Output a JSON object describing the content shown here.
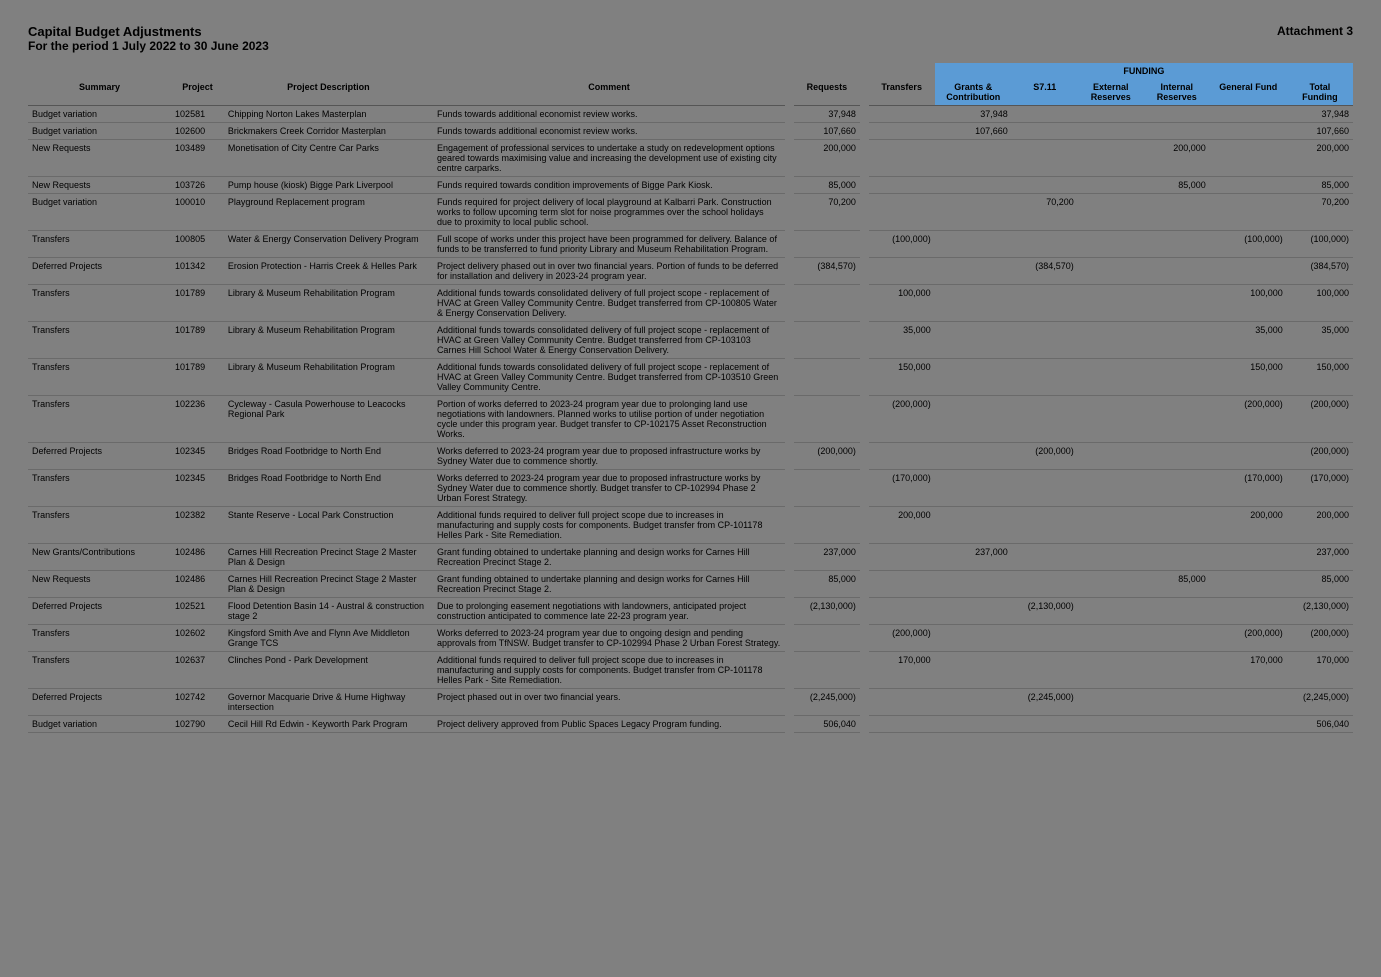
{
  "header": {
    "title": "Capital Budget Adjustments",
    "subtitle": "For the period 1 July 2022 to 30 June 2023",
    "attachment": "Attachment 3"
  },
  "columns": {
    "summary": "Summary",
    "project": "Project",
    "desc": "Project Description",
    "comment": "Comment",
    "requests": "Requests",
    "transfers": "Transfers",
    "grants": "Grants & Contribution",
    "s711": "S7.11",
    "external": "External Reserves",
    "internal": "Internal Reserves",
    "general": "General Fund",
    "total": "Total Funding",
    "funding_group": "FUNDING"
  },
  "rows": [
    {
      "summary": "Budget variation",
      "project": "102581",
      "desc": "Chipping Norton Lakes Masterplan",
      "comment": "Funds towards additional economist review works.",
      "requests": "37,948",
      "transfers": "",
      "grants": "37,948",
      "s711": "",
      "external": "",
      "internal": "",
      "general": "",
      "total": "37,948"
    },
    {
      "summary": "Budget variation",
      "project": "102600",
      "desc": "Brickmakers Creek Corridor Masterplan",
      "comment": "Funds towards additional economist review works.",
      "requests": "107,660",
      "transfers": "",
      "grants": "107,660",
      "s711": "",
      "external": "",
      "internal": "",
      "general": "",
      "total": "107,660"
    },
    {
      "summary": "New Requests",
      "project": "103489",
      "desc": "Monetisation of City Centre Car Parks",
      "comment": "Engagement of professional services to undertake a study on redevelopment options geared towards maximising value and increasing the development use of existing city centre carparks.",
      "requests": "200,000",
      "transfers": "",
      "grants": "",
      "s711": "",
      "external": "",
      "internal": "200,000",
      "general": "",
      "total": "200,000"
    },
    {
      "summary": "New Requests",
      "project": "103726",
      "desc": "Pump house (kiosk) Bigge Park Liverpool",
      "comment": "Funds required towards condition improvements of Bigge Park Kiosk.",
      "requests": "85,000",
      "transfers": "",
      "grants": "",
      "s711": "",
      "external": "",
      "internal": "85,000",
      "general": "",
      "total": "85,000"
    },
    {
      "summary": "Budget variation",
      "project": "100010",
      "desc": "Playground Replacement program",
      "comment": "Funds required for project delivery of local playground at Kalbarri Park. Construction works to follow upcoming term slot for noise programmes over the school holidays due to proximity to local public school.",
      "requests": "70,200",
      "transfers": "",
      "grants": "",
      "s711": "70,200",
      "external": "",
      "internal": "",
      "general": "",
      "total": "70,200"
    },
    {
      "summary": "Transfers",
      "project": "100805",
      "desc": "Water & Energy Conservation Delivery Program",
      "comment": "Full scope of works under this project have been programmed for delivery. Balance of funds to be transferred to fund priority Library and Museum Rehabilitation Program.",
      "requests": "",
      "transfers": "(100,000)",
      "grants": "",
      "s711": "",
      "external": "",
      "internal": "",
      "general": "(100,000)",
      "total": "(100,000)"
    },
    {
      "summary": "Deferred Projects",
      "project": "101342",
      "desc": "Erosion Protection - Harris Creek & Helles Park",
      "comment": "Project delivery phased out in over two financial years. Portion of funds to be deferred for installation and delivery in 2023-24 program year.",
      "requests": "(384,570)",
      "transfers": "",
      "grants": "",
      "s711": "(384,570)",
      "external": "",
      "internal": "",
      "general": "",
      "total": "(384,570)"
    },
    {
      "summary": "Transfers",
      "project": "101789",
      "desc": "Library & Museum Rehabilitation Program",
      "comment": "Additional funds towards consolidated delivery of full project scope - replacement of HVAC at Green Valley Community Centre. Budget transferred from CP-100805 Water & Energy Conservation Delivery.",
      "requests": "",
      "transfers": "100,000",
      "grants": "",
      "s711": "",
      "external": "",
      "internal": "",
      "general": "100,000",
      "total": "100,000"
    },
    {
      "summary": "Transfers",
      "project": "101789",
      "desc": "Library & Museum Rehabilitation Program",
      "comment": "Additional funds towards consolidated delivery of full project scope - replacement of HVAC at Green Valley Community Centre. Budget transferred from CP-103103 Carnes Hill School Water & Energy Conservation Delivery.",
      "requests": "",
      "transfers": "35,000",
      "grants": "",
      "s711": "",
      "external": "",
      "internal": "",
      "general": "35,000",
      "total": "35,000"
    },
    {
      "summary": "Transfers",
      "project": "101789",
      "desc": "Library & Museum Rehabilitation Program",
      "comment": "Additional funds towards consolidated delivery of full project scope - replacement of HVAC at Green Valley Community Centre. Budget transferred from CP-103510 Green Valley Community Centre.",
      "requests": "",
      "transfers": "150,000",
      "grants": "",
      "s711": "",
      "external": "",
      "internal": "",
      "general": "150,000",
      "total": "150,000"
    },
    {
      "summary": "Transfers",
      "project": "102236",
      "desc": "Cycleway - Casula Powerhouse to Leacocks Regional Park",
      "comment": "Portion of works deferred to 2023-24 program year due to prolonging land use negotiations with landowners. Planned works to utilise portion of under negotiation cycle under this program year. Budget transfer to CP-102175 Asset Reconstruction Works.",
      "requests": "",
      "transfers": "(200,000)",
      "grants": "",
      "s711": "",
      "external": "",
      "internal": "",
      "general": "(200,000)",
      "total": "(200,000)"
    },
    {
      "summary": "Deferred Projects",
      "project": "102345",
      "desc": "Bridges Road Footbridge to North End",
      "comment": "Works deferred to 2023-24 program year due to proposed infrastructure works by Sydney Water due to commence shortly.",
      "requests": "(200,000)",
      "transfers": "",
      "grants": "",
      "s711": "(200,000)",
      "external": "",
      "internal": "",
      "general": "",
      "total": "(200,000)"
    },
    {
      "summary": "Transfers",
      "project": "102345",
      "desc": "Bridges Road Footbridge to North End",
      "comment": "Works deferred to 2023-24 program year due to proposed infrastructure works by Sydney Water due to commence shortly. Budget transfer to CP-102994 Phase 2 Urban Forest Strategy.",
      "requests": "",
      "transfers": "(170,000)",
      "grants": "",
      "s711": "",
      "external": "",
      "internal": "",
      "general": "(170,000)",
      "total": "(170,000)"
    },
    {
      "summary": "Transfers",
      "project": "102382",
      "desc": "Stante Reserve - Local Park Construction",
      "comment": "Additional funds required to deliver full project scope due to increases in manufacturing and supply costs for components. Budget transfer from CP-101178 Helles Park - Site Remediation.",
      "requests": "",
      "transfers": "200,000",
      "grants": "",
      "s711": "",
      "external": "",
      "internal": "",
      "general": "200,000",
      "total": "200,000"
    },
    {
      "summary": "New Grants/Contributions",
      "project": "102486",
      "desc": "Carnes Hill Recreation Precinct Stage 2 Master Plan & Design",
      "comment": "Grant funding obtained to undertake planning and design works for Carnes Hill Recreation Precinct Stage 2.",
      "requests": "237,000",
      "transfers": "",
      "grants": "237,000",
      "s711": "",
      "external": "",
      "internal": "",
      "general": "",
      "total": "237,000"
    },
    {
      "summary": "New Requests",
      "project": "102486",
      "desc": "Carnes Hill Recreation Precinct Stage 2 Master Plan & Design",
      "comment": "Grant funding obtained to undertake planning and design works for Carnes Hill Recreation Precinct Stage 2.",
      "requests": "85,000",
      "transfers": "",
      "grants": "",
      "s711": "",
      "external": "",
      "internal": "85,000",
      "general": "",
      "total": "85,000"
    },
    {
      "summary": "Deferred Projects",
      "project": "102521",
      "desc": "Flood Detention Basin 14 - Austral & construction stage 2",
      "comment": "Due to prolonging easement negotiations with landowners, anticipated project construction anticipated to commence late 22-23 program year.",
      "requests": "(2,130,000)",
      "transfers": "",
      "grants": "",
      "s711": "(2,130,000)",
      "external": "",
      "internal": "",
      "general": "",
      "total": "(2,130,000)"
    },
    {
      "summary": "Transfers",
      "project": "102602",
      "desc": "Kingsford Smith Ave and Flynn Ave Middleton Grange TCS",
      "comment": "Works deferred to 2023-24 program year due to ongoing design and pending approvals from TfNSW. Budget transfer to CP-102994 Phase 2 Urban Forest Strategy.",
      "requests": "",
      "transfers": "(200,000)",
      "grants": "",
      "s711": "",
      "external": "",
      "internal": "",
      "general": "(200,000)",
      "total": "(200,000)"
    },
    {
      "summary": "Transfers",
      "project": "102637",
      "desc": "Clinches Pond - Park Development",
      "comment": "Additional funds required to deliver full project scope due to increases in manufacturing and supply costs for components. Budget transfer from CP-101178 Helles Park - Site Remediation.",
      "requests": "",
      "transfers": "170,000",
      "grants": "",
      "s711": "",
      "external": "",
      "internal": "",
      "general": "170,000",
      "total": "170,000"
    },
    {
      "summary": "Deferred Projects",
      "project": "102742",
      "desc": "Governor Macquarie Drive & Hume Highway intersection",
      "comment": "Project phased out in over two financial years.",
      "requests": "(2,245,000)",
      "transfers": "",
      "grants": "",
      "s711": "(2,245,000)",
      "external": "",
      "internal": "",
      "general": "",
      "total": "(2,245,000)"
    },
    {
      "summary": "Budget variation",
      "project": "102790",
      "desc": "Cecil Hill Rd Edwin - Keyworth Park Program",
      "comment": "Project delivery approved from Public Spaces Legacy Program funding.",
      "requests": "506,040",
      "transfers": "",
      "grants": "",
      "s711": "",
      "external": "",
      "internal": "",
      "general": "",
      "total": "506,040"
    }
  ]
}
